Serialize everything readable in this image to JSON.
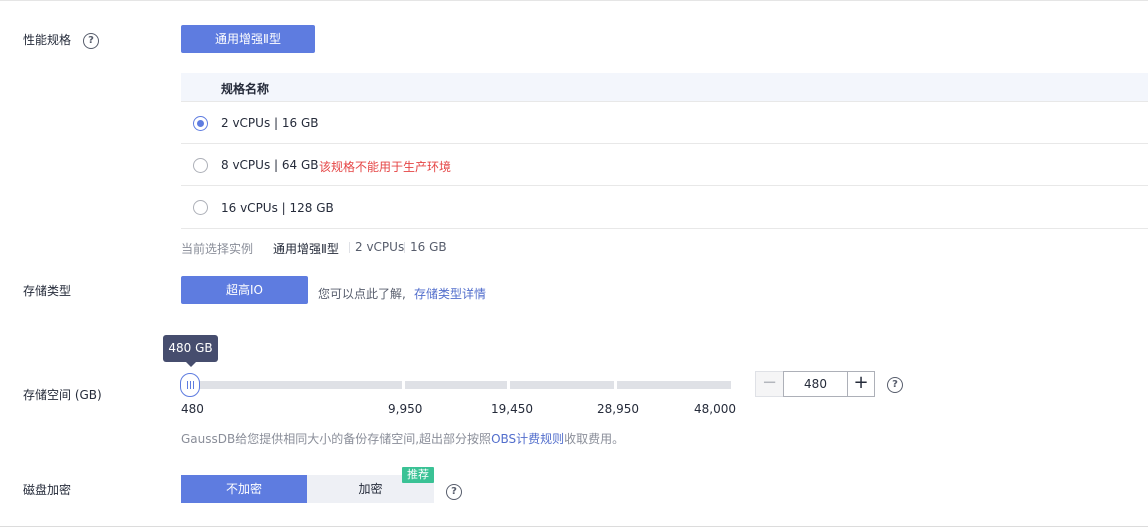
{
  "performance": {
    "label": "性能规格",
    "spec_button": "通用增强Ⅱ型",
    "table_header": "规格名称",
    "rows": [
      {
        "text": "2 vCPUs | 16 GB",
        "warning": "",
        "selected": true
      },
      {
        "text": "8 vCPUs | 64 GB",
        "warning": "该规格不能用于生产环境",
        "selected": false
      },
      {
        "text": "16 vCPUs | 128 GB",
        "warning": "",
        "selected": false
      }
    ],
    "current_label": "当前选择实例",
    "current_type": "通用增强Ⅱ型",
    "current_cpu": "2 vCPUs",
    "current_mem": "16 GB"
  },
  "storage_type": {
    "label": "存储类型",
    "button": "超高IO",
    "hint": "您可以点此了解,",
    "link": "存储类型详情"
  },
  "storage_space": {
    "label": "存储空间 (GB)",
    "tooltip": "480 GB",
    "ticks": [
      "480",
      "9,950",
      "19,450",
      "28,950",
      "48,000"
    ],
    "value": "480",
    "minus": "−",
    "plus": "+",
    "note_prefix": "GaussDB给您提供相同大小的备份存储空间,超出部分按照",
    "note_link": "OBS计费规则",
    "note_suffix": "收取费用。"
  },
  "encryption": {
    "label": "磁盘加密",
    "off": "不加密",
    "on": "加密",
    "badge": "推荐"
  },
  "help_glyph": "?",
  "colors": {
    "primary": "#5e7ce0",
    "warning": "#e54545",
    "link": "#526ecc",
    "badge": "#3ac295"
  }
}
